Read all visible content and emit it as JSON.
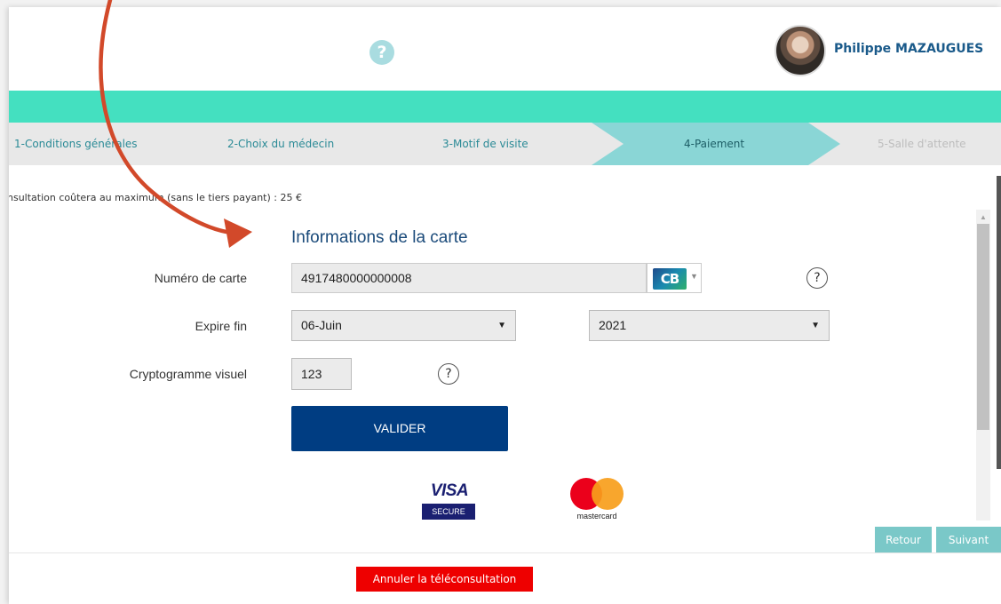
{
  "header": {
    "help_icon": "?",
    "user_name": "Philippe MAZAUGUES"
  },
  "steps": [
    {
      "label": "1-Conditions générales",
      "state": "done"
    },
    {
      "label": "2-Choix du médecin",
      "state": "done"
    },
    {
      "label": "3-Motif de visite",
      "state": "done"
    },
    {
      "label": "4-Paiement",
      "state": "active"
    },
    {
      "label": "5-Salle d'attente",
      "state": "upcoming"
    }
  ],
  "price_info": "nsultation coûtera au maximum (sans le tiers payant) : 25 €",
  "card_form": {
    "title": "Informations de la carte",
    "card_number_label": "Numéro de carte",
    "card_number_value": "4917480000000008",
    "card_type_logo": "CB",
    "expiry_label": "Expire fin",
    "expiry_month": "06-Juin",
    "expiry_year": "2021",
    "cvv_label": "Cryptogramme visuel",
    "cvv_value": "123",
    "help_icon": "?",
    "submit_label": "VALIDER"
  },
  "logos": {
    "visa_word": "VISA",
    "visa_secure": "SECURE",
    "mastercard_word": "mastercard"
  },
  "nav": {
    "back_label": "Retour",
    "next_label": "Suivant",
    "cancel_label": "Annuler la téléconsultation"
  },
  "colors": {
    "teal_band": "#44e0c0",
    "active_step": "#8ad6d6",
    "primary_button": "#003d82",
    "cancel_button": "#ee0000",
    "annotation_arrow": "#d2492a"
  }
}
